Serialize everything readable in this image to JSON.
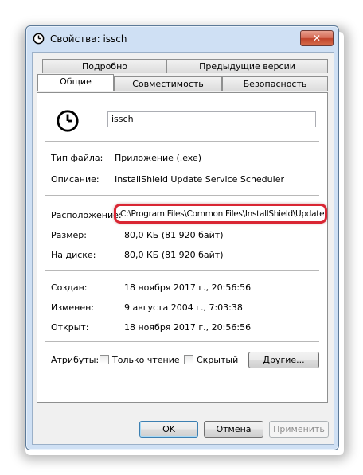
{
  "window": {
    "title": "Свойства: issch",
    "close_label": "✕"
  },
  "tabs": {
    "row1": [
      "Подробно",
      "Предыдущие версии"
    ],
    "row2": [
      "Общие",
      "Совместимость",
      "Безопасность"
    ],
    "active": "Общие"
  },
  "general": {
    "file_name": "issch",
    "file_type_label": "Тип файла:",
    "file_type_value": "Приложение (.exe)",
    "description_label": "Описание:",
    "description_value": "InstallShield Update Service Scheduler",
    "location_label": "Расположение:",
    "location_value": "C:\\Program Files\\Common Files\\InstallShield\\Update",
    "size_label": "Размер:",
    "size_value": "80,0 КБ (81 920 байт)",
    "disk_label": "На диске:",
    "disk_value": "80,0 КБ (81 920 байт)",
    "created_label": "Создан:",
    "created_value": "18 ноября 2017 г., 20:56:56",
    "modified_label": "Изменен:",
    "modified_value": "9 августа 2004 г., 7:03:38",
    "opened_label": "Открыт:",
    "opened_value": "18 ноября 2017 г., 20:56:56",
    "attributes_label": "Атрибуты:",
    "readonly_label": "Только чтение",
    "readonly_checked": false,
    "hidden_label": "Скрытый",
    "hidden_checked": false,
    "other_button": "Другие..."
  },
  "footer": {
    "ok": "OK",
    "cancel": "Отмена",
    "apply": "Применить"
  },
  "colors": {
    "highlight": "#d92633",
    "window_frame": "#cfe0f4"
  }
}
